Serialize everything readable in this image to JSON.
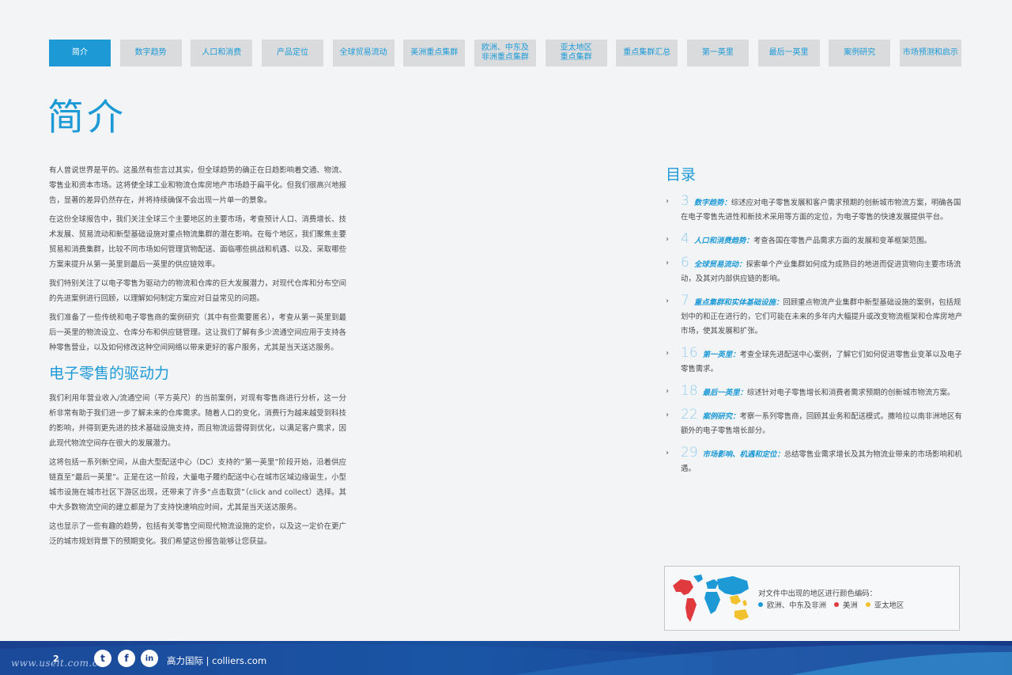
{
  "tabs": [
    {
      "label": "简介",
      "active": true
    },
    {
      "label": "数字趋势"
    },
    {
      "label": "人口和消费"
    },
    {
      "label": "产品定位"
    },
    {
      "label": "全球贸易流动"
    },
    {
      "label": "美洲重点集群"
    },
    {
      "label": "欧洲、中东及\n非洲重点集群"
    },
    {
      "label": "亚太地区\n重点集群"
    },
    {
      "label": "重点集群汇总"
    },
    {
      "label": "第一英里"
    },
    {
      "label": "最后一英里"
    },
    {
      "label": "案例研究"
    },
    {
      "label": "市场预测和启示"
    }
  ],
  "page_title": "简介",
  "left": {
    "paragraphs_a": [
      "有人曾说世界是平的。这虽然有些言过其实，但全球趋势的确正在日趋影响着交通、物流、零售业和资本市场。这将使全球工业和物流仓库房地产市场趋于扁平化。但我们很高兴地报告，显著的差异仍然存在，并将持续确保不会出现一片单一的景象。",
      "在这份全球报告中，我们关注全球三个主要地区的主要市场，考查预计人口、消费增长、技术发展、贸易流动和新型基础设施对重点物流集群的潜在影响。在每个地区，我们聚焦主要贸易和消费集群，比较不同市场如何管理货物配送、面临哪些挑战和机遇、以及、采取哪些方案来提升从第一英里到最后一英里的供应链效率。",
      "我们特别关注了以电子零售为驱动力的物流和仓库的巨大发展潜力，对现代仓库和分布空间的先进案例进行回顾，以理解如何制定方案应对日益常见的问题。",
      "我们准备了一些传统和电子零售商的案例研究（其中有些需要匿名），考查从第一英里到最后一英里的物流设立、仓库分布和供应链管理。这让我们了解有多少流通空间应用于支持各种零售营业，以及如何修改这种空间网络以带来更好的客户服务，尤其是当天送达服务。"
    ],
    "subheading": "电子零售的驱动力",
    "paragraphs_b": [
      "我们利用年营业收入/流通空间（平方英尺）的当前案例，对现有零售商进行分析，这一分析非常有助于我们进一步了解未来的仓库需求。随着人口的变化，消费行为越来越受到科技的影响，并得到更先进的技术基础设施支持，而且物流运营得到优化，以满足客户需求，因此现代物流空间存在很大的发展潜力。",
      "这将包括一系列新空间，从由大型配送中心（DC）支持的“第一英里”阶段开始，沿着供应链直至“最后一英里”。正是在这一阶段，大量电子履约配送中心在城市区域边缘诞生，小型城市设施在城市社区下游区出现，还带来了许多“点击取货”（click and collect）选择。其中大多数物流空间的建立都是为了支持快速响应时间，尤其是当天送达服务。",
      "这也显示了一些有趣的趋势，包括有关零售空间现代物流设施的定价，以及这一定价在更广泛的城市规划背景下的预期变化。我们希望这份报告能够让您获益。"
    ]
  },
  "toc": {
    "heading": "目录",
    "items": [
      {
        "num": "3",
        "title": "数字趋势：",
        "text": "综述应对电子零售发展和客户需求预期的创新城市物流方案，明确各国在电子零售先进性和新技术采用等方面的定位，为电子零售的快速发展提供平台。"
      },
      {
        "num": "4",
        "title": "人口和消费趋势：",
        "text": "考查各国在零售产品需求方面的发展和变革框架范围。"
      },
      {
        "num": "6",
        "title": "全球贸易流动：",
        "text": "探索单个产业集群如何成为成熟目的地进而促进货物向主要市场流动，及其对内部供应链的影响。"
      },
      {
        "num": "7",
        "title": "重点集群和实体基础设施：",
        "text": "回顾重点物流产业集群中新型基础设施的案例，包括规划中的和正在进行的，它们可能在未来的多年内大幅提升或改变物流框架和仓库房地产市场，使其发展和扩张。"
      },
      {
        "num": "16",
        "title": "第一英里：",
        "text": "考查全球先进配送中心案例，了解它们如何促进零售业变革以及电子零售需求。"
      },
      {
        "num": "18",
        "title": "最后一英里：",
        "text": "综述针对电子零售增长和消费者需求预期的创新城市物流方案。"
      },
      {
        "num": "22",
        "title": "案例研究：",
        "text": "考察一系列零售商，回顾其业务和配送模式。撒哈拉以南非洲地区有额外的电子零售增长部分。"
      },
      {
        "num": "29",
        "title": "市场影响、机遇和定位：",
        "text": "总结零售业需求增长及其为物流业带来的市场影响和机遇。"
      }
    ]
  },
  "legend": {
    "title": "对文件中出现的地区进行颜色编码：",
    "items": [
      {
        "label": "欧洲、中东及非洲",
        "color": "#1d9ad6"
      },
      {
        "label": "美洲",
        "color": "#e03a3e"
      },
      {
        "label": "亚太地区",
        "color": "#f2c12e"
      }
    ]
  },
  "footer": {
    "page_number": "2",
    "watermark": "www.useit.com.cn",
    "brand": "高力国际 | colliers.com",
    "social": [
      {
        "icon": "twitter-icon",
        "glyph": "t"
      },
      {
        "icon": "facebook-icon",
        "glyph": "f"
      },
      {
        "icon": "linkedin-icon",
        "glyph": "in"
      }
    ]
  }
}
